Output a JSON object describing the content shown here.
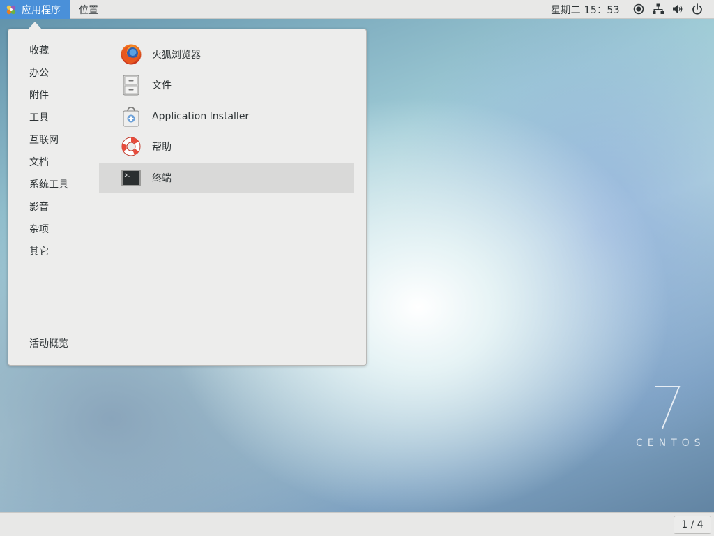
{
  "topbar": {
    "applications_label": "应用程序",
    "places_label": "位置",
    "clock": "星期二 15：53",
    "tray_icons": [
      "accessibility-icon",
      "network-icon",
      "volume-icon",
      "power-icon"
    ]
  },
  "menu": {
    "categories": [
      {
        "label": "收藏"
      },
      {
        "label": "办公"
      },
      {
        "label": "附件"
      },
      {
        "label": "工具"
      },
      {
        "label": "互联网"
      },
      {
        "label": "文档"
      },
      {
        "label": "系统工具"
      },
      {
        "label": "影音"
      },
      {
        "label": "杂项"
      },
      {
        "label": "其它"
      }
    ],
    "activities_label": "活动概览",
    "apps": [
      {
        "label": "火狐浏览器",
        "icon": "firefox-icon"
      },
      {
        "label": "文件",
        "icon": "files-icon"
      },
      {
        "label": "Application Installer",
        "icon": "software-installer-icon"
      },
      {
        "label": "帮助",
        "icon": "help-icon"
      },
      {
        "label": "终端",
        "icon": "terminal-icon",
        "selected": true
      }
    ]
  },
  "desktop": {
    "watermark_number": "7",
    "watermark_text": "CENTOS"
  },
  "bottombar": {
    "workspace": "1 / 4"
  },
  "colors": {
    "accent": "#4a90d9",
    "panel": "#e8e8e7",
    "menu_bg": "#ededec",
    "selected_row": "#d9d9d8"
  }
}
